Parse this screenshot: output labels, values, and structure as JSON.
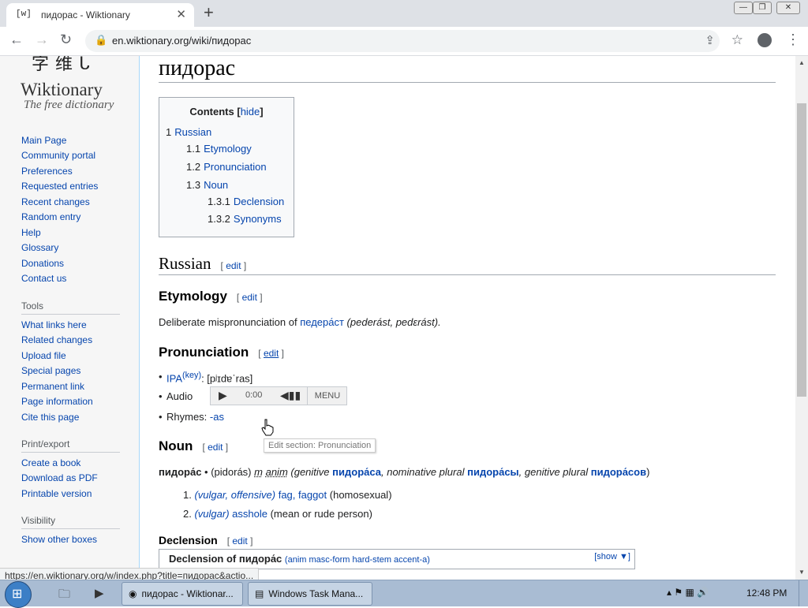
{
  "browser": {
    "tab_favicon": "[w]",
    "tab_title": "пидорас - Wiktionary",
    "tab_close": "✕",
    "new_tab": "+",
    "url": "en.wiktionary.org/wiki/пидорас",
    "win_minimize": "—",
    "win_restore": "❐",
    "win_close": "✕"
  },
  "sidebar": {
    "logo_chars": "字维ᒐ",
    "logo_title": "Wiktionary",
    "logo_tagline": "The free dictionary",
    "nav": [
      "Main Page",
      "Community portal",
      "Preferences",
      "Requested entries",
      "Recent changes",
      "Random entry",
      "Help",
      "Glossary",
      "Donations",
      "Contact us"
    ],
    "tools_heading": "Tools",
    "tools": [
      "What links here",
      "Related changes",
      "Upload file",
      "Special pages",
      "Permanent link",
      "Page information",
      "Cite this page"
    ],
    "print_heading": "Print/export",
    "print": [
      "Create a book",
      "Download as PDF",
      "Printable version"
    ],
    "visibility_heading": "Visibility",
    "visibility": [
      "Show other boxes"
    ]
  },
  "article": {
    "title": "пидорас",
    "toc_title": "Contents",
    "toc_hide": "hide",
    "toc": [
      {
        "num": "1",
        "label": "Russian"
      },
      {
        "num": "1.1",
        "label": "Etymology"
      },
      {
        "num": "1.2",
        "label": "Pronunciation"
      },
      {
        "num": "1.3",
        "label": "Noun"
      },
      {
        "num": "1.3.1",
        "label": "Declension"
      },
      {
        "num": "1.3.2",
        "label": "Synonyms"
      }
    ],
    "edit": "edit",
    "h_russian": "Russian",
    "h_etymology": "Etymology",
    "etym_text_1": "Deliberate mispronunciation of ",
    "etym_link": "педера́ст",
    "etym_text_2": " (pederást, pedɛrást).",
    "h_pronunciation": "Pronunciation",
    "ipa_label": "IPA",
    "ipa_key": "(key)",
    "ipa_value": ": [pʲɪdɐˈras]",
    "audio_label": "Audio",
    "audio_time": "0:00",
    "audio_menu": "MENU",
    "rhymes_label": "Rhymes: ",
    "rhymes_link": "-as",
    "tooltip": "Edit section: Pronunciation",
    "h_noun": "Noun",
    "headword": "пидора́с",
    "headword_rest": " • (pidorás) ",
    "gender": "m",
    "anim": "anim",
    "gen_label": " (genitive ",
    "gen_form": "пидора́са",
    "nom_pl_label": ", nominative plural ",
    "nom_pl_form": "пидора́сы",
    "gen_pl_label": ", genitive plural ",
    "gen_pl_form": "пидора́сов",
    "close_paren": ")",
    "senses": [
      {
        "num": "1.",
        "tags": "(vulgar, offensive)",
        "links": "fag, faggot",
        "gloss": " (homosexual)"
      },
      {
        "num": "2.",
        "tags": "(vulgar)",
        "links": "asshole",
        "gloss": " (mean or rude person)"
      }
    ],
    "h_declension": "Declension",
    "decl_box_title": "Declension of пидора́с",
    "decl_box_sub": "(anim masc-form hard-stem accent-a)",
    "decl_show": "[show ▼]"
  },
  "status_url": "https://en.wiktionary.org/w/index.php?title=пидорас&actio...",
  "taskbar": {
    "chrome_task": "пидорас - Wiktionar...",
    "taskmgr_task": "Windows Task Mana...",
    "clock": "12:48 PM"
  }
}
